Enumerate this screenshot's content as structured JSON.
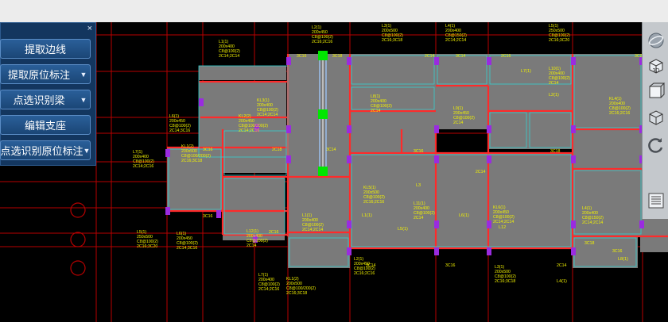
{
  "panel": {
    "close_glyph": "×",
    "buttons": [
      {
        "label": "提取边线",
        "dropdown": false
      },
      {
        "label": "提取原位标注",
        "dropdown": true
      },
      {
        "label": "点选识别梁",
        "dropdown": true
      },
      {
        "label": "编辑支座",
        "dropdown": false
      },
      {
        "label": "点选识别原位标注",
        "dropdown": true
      }
    ]
  },
  "view_toolbar": {
    "view3d_label": "3D",
    "icons": [
      "navigation-sphere-icon",
      "view-3d-cube-icon",
      "front-view-cube-icon",
      "iso-view-cube-icon",
      "rotate-icon",
      "layer-panel-icon"
    ]
  },
  "drawing": {
    "colors": {
      "background": "#000000",
      "grid": "#b80000",
      "beam": "#ff2a2a",
      "slab_fill": "#7a7a7a",
      "outline": "#35d0d0",
      "annotation": "#f2f200",
      "support": "#9a2be0",
      "selected_beam": "#9ec9ff",
      "grip": "#00e600"
    },
    "annotations": [
      {
        "lines": [
          "L1(1)",
          "200x400",
          "C8@100(2)",
          "2C14;2C14"
        ]
      },
      {
        "lines": [
          "L2(1)",
          "200x450",
          "C8@100(2)",
          "2C16;2C16"
        ]
      },
      {
        "lines": [
          "L3(1)",
          "200x500",
          "C8@100(2)",
          "2C16;3C18"
        ]
      },
      {
        "lines": [
          "L4(1)",
          "200x400",
          "C8@150(2)",
          "2C14;2C14"
        ]
      },
      {
        "lines": [
          "L5(1)",
          "250x500",
          "C8@100(2)",
          "2C16;3C20"
        ]
      },
      {
        "lines": [
          "L6(1)",
          "200x450",
          "C8@100(2)",
          "2C14;3C16"
        ]
      },
      {
        "lines": [
          "L7(1)",
          "200x400",
          "C8@100(2)",
          "2C14;2C16"
        ]
      },
      {
        "lines": [
          "KL1(2)",
          "200x500",
          "C8@100/200(2)",
          "2C16;3C18"
        ]
      },
      {
        "lines": [
          "KL2(2)",
          "200x450",
          "C8@100/200(2)",
          "2C14;2C16"
        ]
      },
      {
        "lines": [
          "KL3(1)",
          "200x400",
          "C8@100(2)",
          "2C14;2C14"
        ]
      },
      {
        "lines": [
          "L8(1)",
          "200x400",
          "C8@100(2)",
          "2C14"
        ]
      },
      {
        "lines": [
          "L9(1)",
          "200x450",
          "C8@100(2)",
          "2C14"
        ]
      },
      {
        "lines": [
          "L10(1)",
          "200x400",
          "C8@100(2)",
          "2C14"
        ]
      },
      {
        "lines": [
          "KL4(1)",
          "200x400",
          "C8@100(2)",
          "2C16;2C16"
        ]
      },
      {
        "lines": [
          "L11(1)",
          "200x400",
          "C8@100(2)",
          "2C14"
        ]
      },
      {
        "lines": [
          "KL5(1)",
          "200x500",
          "C8@100(2)",
          "2C16;2C16"
        ]
      },
      {
        "lines": [
          "KL6(1)",
          "200x450",
          "C8@100(2)",
          "2C14;2C14"
        ]
      },
      {
        "lines": [
          "L12(1)",
          "200x400",
          "C8@100(2)",
          "2C14"
        ]
      }
    ],
    "span_labels": [
      "3C16",
      "3C18",
      "2C14",
      "3C14",
      "2C16",
      "3C20",
      "3C16",
      "2C18",
      "3C14",
      "3C16",
      "2C14",
      "3C18",
      "3C16",
      "2C16",
      "3C14",
      "3C16",
      "2C14",
      "3C18",
      "3C16"
    ],
    "room_labels": [
      "L7(1)",
      "L2(1)",
      "L12",
      "L5(1)",
      "L6(1)",
      "L1(1)",
      "L8(1)",
      "L4(1)",
      "L3"
    ]
  }
}
